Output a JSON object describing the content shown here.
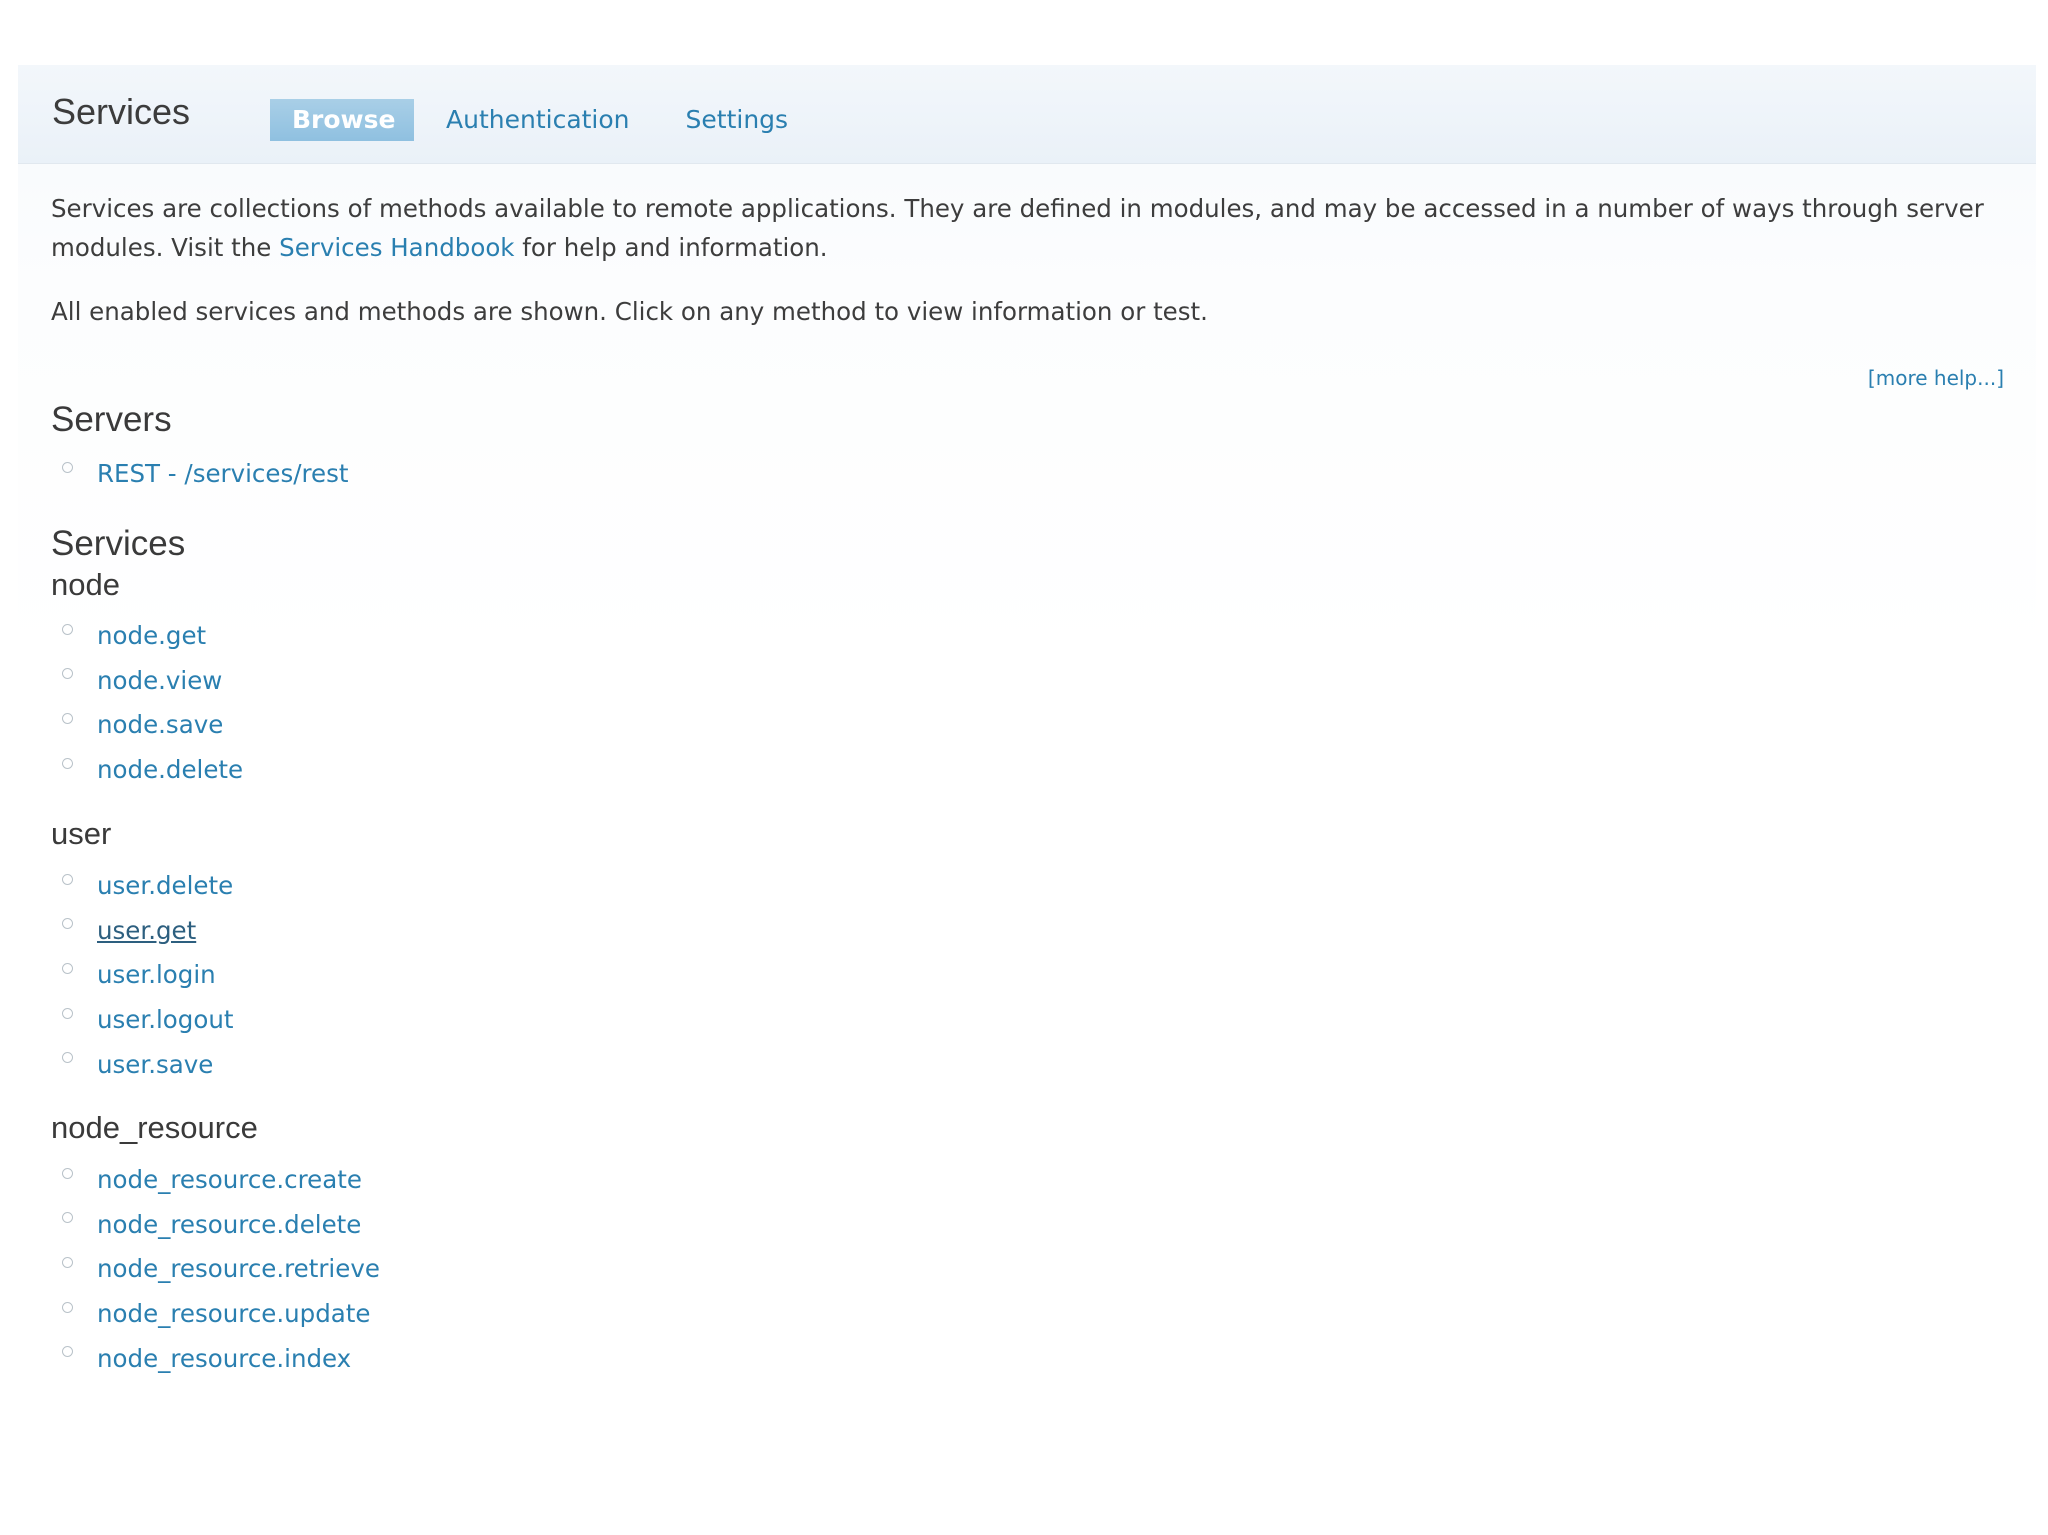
{
  "page": {
    "title": "Services"
  },
  "tabs": [
    {
      "label": "Browse",
      "active": true
    },
    {
      "label": "Authentication",
      "active": false
    },
    {
      "label": "Settings",
      "active": false
    }
  ],
  "intro": {
    "text_before_link": "Services are collections of methods available to remote applications. They are defined in modules, and may be accessed in a number of ways through server modules. Visit the ",
    "link_label": "Services Handbook",
    "text_after_link": " for help and information.",
    "line2": "All enabled services and methods are shown. Click on any method to view information or test."
  },
  "more_help_label": "[more help...]",
  "servers": {
    "heading": "Servers",
    "items": [
      "REST - /services/rest"
    ]
  },
  "services": {
    "heading": "Services",
    "groups": [
      {
        "name": "node",
        "methods": [
          "node.get",
          "node.view",
          "node.save",
          "node.delete"
        ]
      },
      {
        "name": "user",
        "methods": [
          "user.delete",
          "user.get",
          "user.login",
          "user.logout",
          "user.save"
        ]
      },
      {
        "name": "node_resource",
        "methods": [
          "node_resource.create",
          "node_resource.delete",
          "node_resource.retrieve",
          "node_resource.update",
          "node_resource.index"
        ]
      }
    ]
  },
  "colors": {
    "link": "#2a7fb0",
    "active_tab_bg": "#9ac6e3",
    "text": "#3a3a3a",
    "header_bg": "#eef4f9"
  }
}
